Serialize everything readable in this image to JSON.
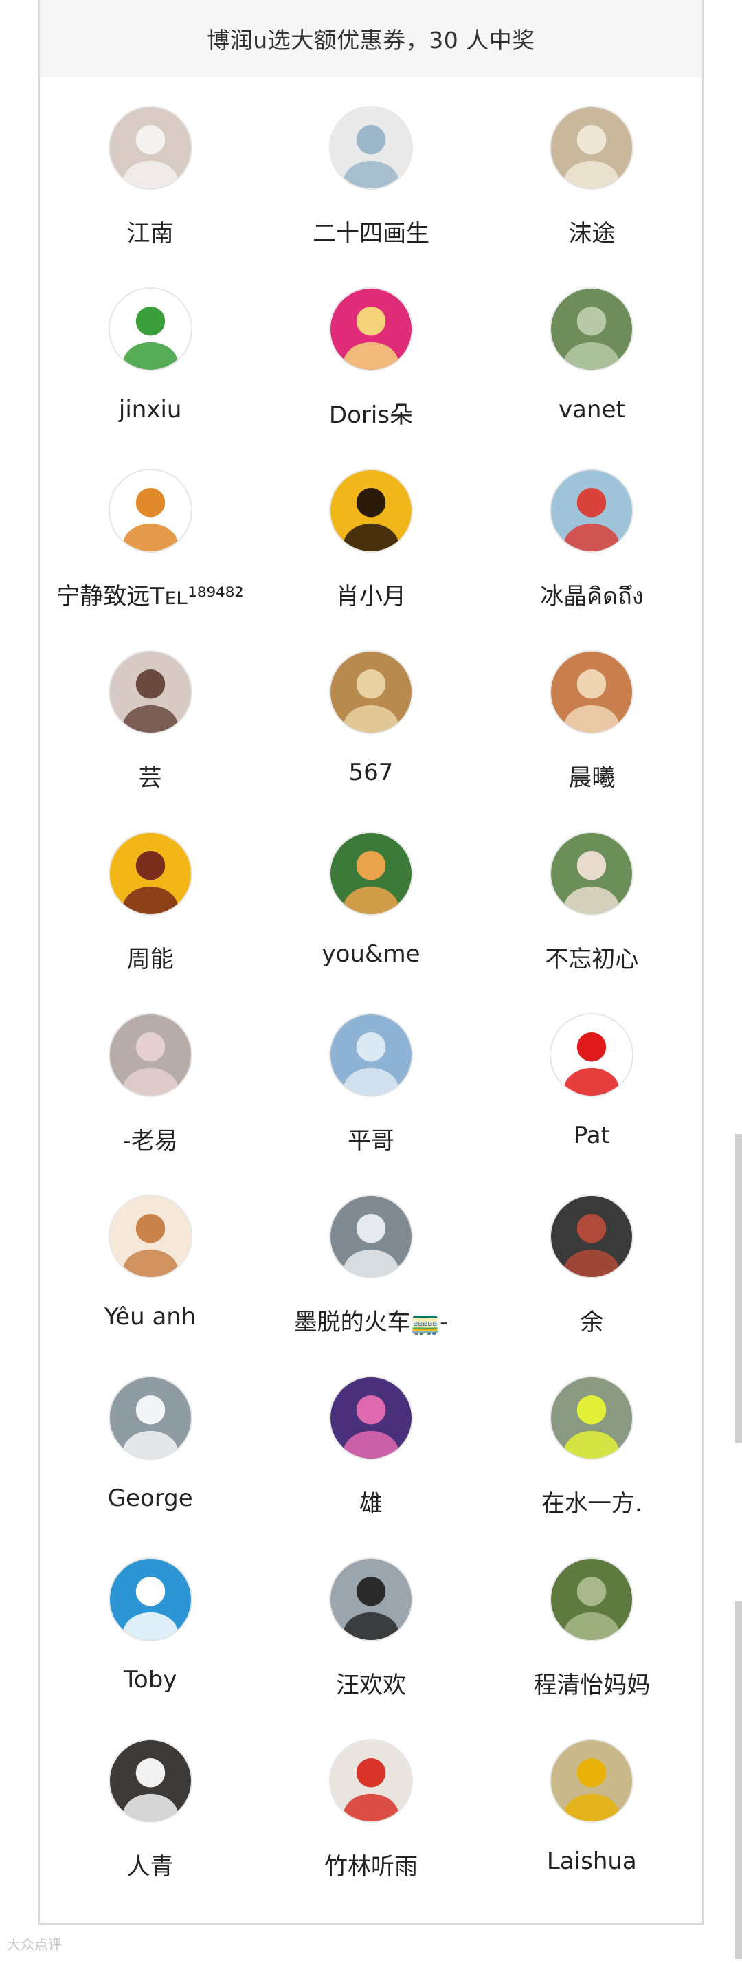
{
  "header": {
    "title": "博润u选大额优惠券，30 人中奖"
  },
  "winners": [
    {
      "name": "江南",
      "bg": "#d8cbc3",
      "fg": "#f4f1ef",
      "icon": "photo-avatar-icon"
    },
    {
      "name": "二十四画生",
      "bg": "#e9e9e9",
      "fg": "#9bb7c9",
      "icon": "sketch-avatar-icon"
    },
    {
      "name": "沫途",
      "bg": "#c9b89c",
      "fg": "#efe7d6",
      "icon": "dog-avatar-icon"
    },
    {
      "name": "jinxiu",
      "bg": "#ffffff",
      "fg": "#3a9e3a",
      "icon": "clover-avatar-icon"
    },
    {
      "name": "Doris朵",
      "bg": "#e02b79",
      "fg": "#f5d37a",
      "icon": "cartoon-avatar-icon"
    },
    {
      "name": "vanet",
      "bg": "#6f8d5a",
      "fg": "#b7c9a7",
      "icon": "tree-avatar-icon"
    },
    {
      "name": "宁静致远Tᴇʟ¹⁸⁹⁴⁸²",
      "bg": "#ffffff",
      "fg": "#e08a2b",
      "icon": "rabbit-avatar-icon"
    },
    {
      "name": "肖小月",
      "bg": "#f0b61a",
      "fg": "#2a1a0a",
      "icon": "sunset-avatar-icon"
    },
    {
      "name": "冰晶คิดถึง",
      "bg": "#9fc4d9",
      "fg": "#d8423a",
      "icon": "photo-avatar-icon"
    },
    {
      "name": "芸",
      "bg": "#d7c9c4",
      "fg": "#6a4a3f",
      "icon": "photo-avatar-icon"
    },
    {
      "name": "567",
      "bg": "#b98a4e",
      "fg": "#e8d2a3",
      "icon": "dog-avatar-icon"
    },
    {
      "name": "晨曦",
      "bg": "#c97f4d",
      "fg": "#f0d5b5",
      "icon": "photo-avatar-icon"
    },
    {
      "name": "周能",
      "bg": "#f3b619",
      "fg": "#7a2d1a",
      "icon": "motorbike-avatar-icon"
    },
    {
      "name": "you&me",
      "bg": "#3c7a3a",
      "fg": "#e9a34a",
      "icon": "cartoon-avatar-icon"
    },
    {
      "name": "不忘初心",
      "bg": "#6c8f5a",
      "fg": "#e8dccc",
      "icon": "photo-avatar-icon"
    },
    {
      "name": "-老易",
      "bg": "#b7aca7",
      "fg": "#e5cfcf",
      "icon": "pig-avatar-icon"
    },
    {
      "name": "平哥",
      "bg": "#8fb3d4",
      "fg": "#dce8f2",
      "icon": "sea-avatar-icon"
    },
    {
      "name": "Pat",
      "bg": "#ffffff",
      "fg": "#e01a1a",
      "icon": "flower-avatar-icon"
    },
    {
      "name": "Yêu anh",
      "bg": "#f6e8d8",
      "fg": "#c9834a",
      "icon": "anime-avatar-icon"
    },
    {
      "name": "墨脱的火车🚃-",
      "bg": "#7f8a93",
      "fg": "#e6eaee",
      "icon": "street-avatar-icon"
    },
    {
      "name": "余",
      "bg": "#3a3a3a",
      "fg": "#b04a3a",
      "icon": "photo-avatar-icon"
    },
    {
      "name": "George",
      "bg": "#8f9ba3",
      "fg": "#f2f4f6",
      "icon": "mountain-avatar-icon"
    },
    {
      "name": "雄",
      "bg": "#4a2f7a",
      "fg": "#e06ab0",
      "icon": "night-city-avatar-icon"
    },
    {
      "name": "在水一方.",
      "bg": "#8a9a82",
      "fg": "#e2f03a",
      "icon": "runner-avatar-icon"
    },
    {
      "name": "Toby",
      "bg": "#2d95d4",
      "fg": "#ffffff",
      "icon": "surf-avatar-icon"
    },
    {
      "name": "汪欢欢",
      "bg": "#9aa5ad",
      "fg": "#2a2a2a",
      "icon": "photo-avatar-icon"
    },
    {
      "name": "程清怡妈妈",
      "bg": "#5e7a3e",
      "fg": "#a8b88a",
      "icon": "nature-avatar-icon"
    },
    {
      "name": "人青",
      "bg": "#3e3a38",
      "fg": "#f2f2f2",
      "icon": "cloud-avatar-icon"
    },
    {
      "name": "竹林听雨",
      "bg": "#e9e4de",
      "fg": "#d8342a",
      "icon": "cartoon-avatar-icon"
    },
    {
      "name": "Laishua",
      "bg": "#c9b98a",
      "fg": "#e8b20a",
      "icon": "bear-avatar-icon"
    }
  ],
  "footer": {
    "watermark": "大众点评"
  }
}
